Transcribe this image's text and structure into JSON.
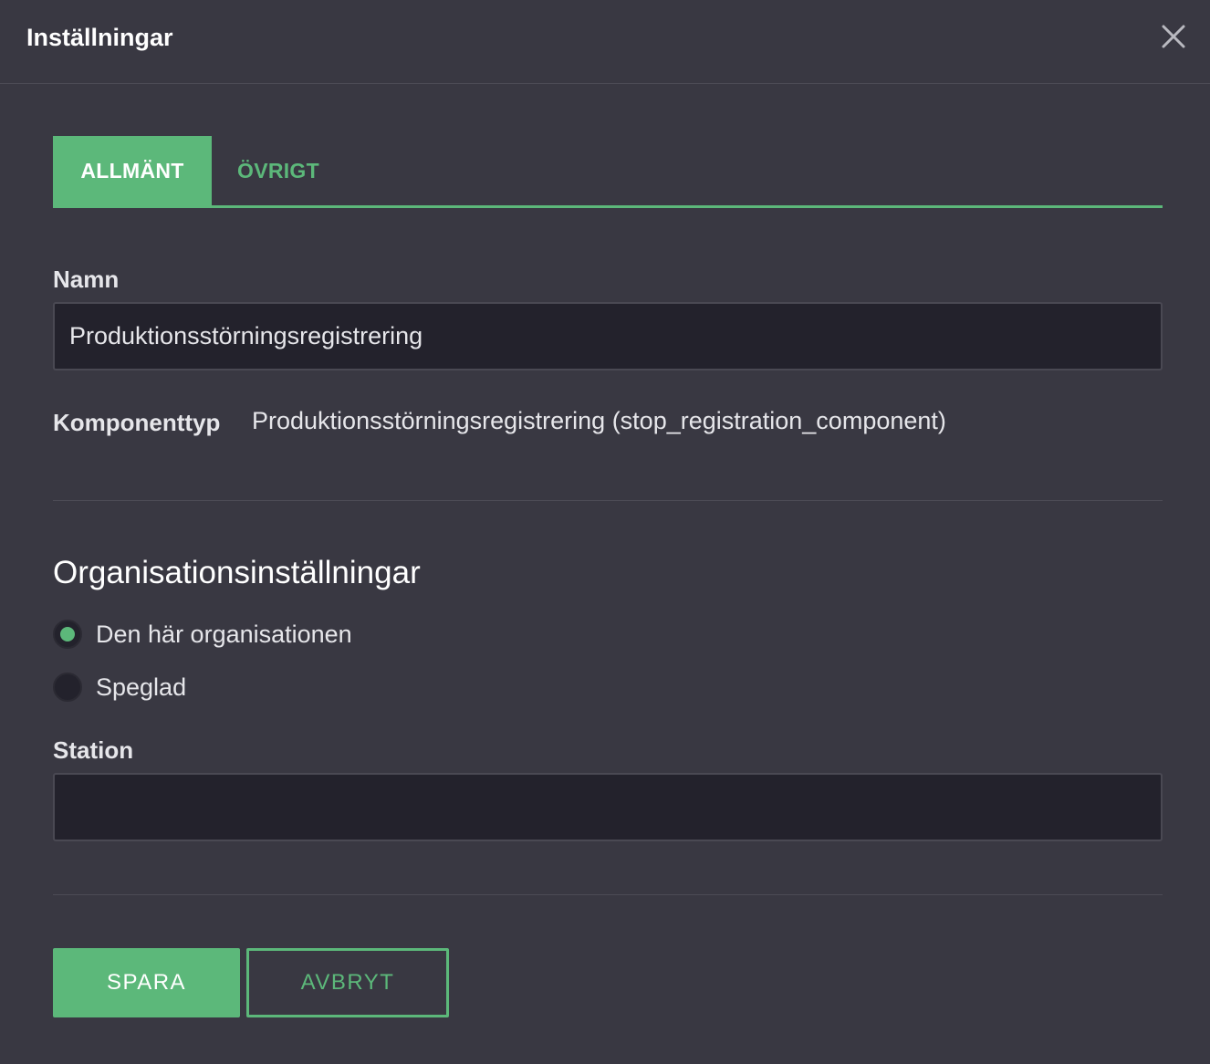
{
  "dialog": {
    "title": "Inställningar",
    "close_icon": "close-icon"
  },
  "tabs": [
    {
      "label": "ALLMÄNT",
      "active": true
    },
    {
      "label": "ÖVRIGT",
      "active": false
    }
  ],
  "form": {
    "name_label": "Namn",
    "name_value": "Produktionsstörningsregistrering",
    "component_type_label": "Komponenttyp",
    "component_type_value": "Produktionsstörningsregistrering (stop_registration_component)",
    "org_section_title": "Organisationsinställningar",
    "org_options": [
      {
        "label": "Den här organisationen",
        "selected": true
      },
      {
        "label": "Speglad",
        "selected": false
      }
    ],
    "station_label": "Station",
    "station_value": ""
  },
  "actions": {
    "save_label": "SPARA",
    "cancel_label": "AVBRYT"
  },
  "colors": {
    "background": "#393842",
    "accent": "#5cb87a",
    "input_bg": "#23222c"
  }
}
